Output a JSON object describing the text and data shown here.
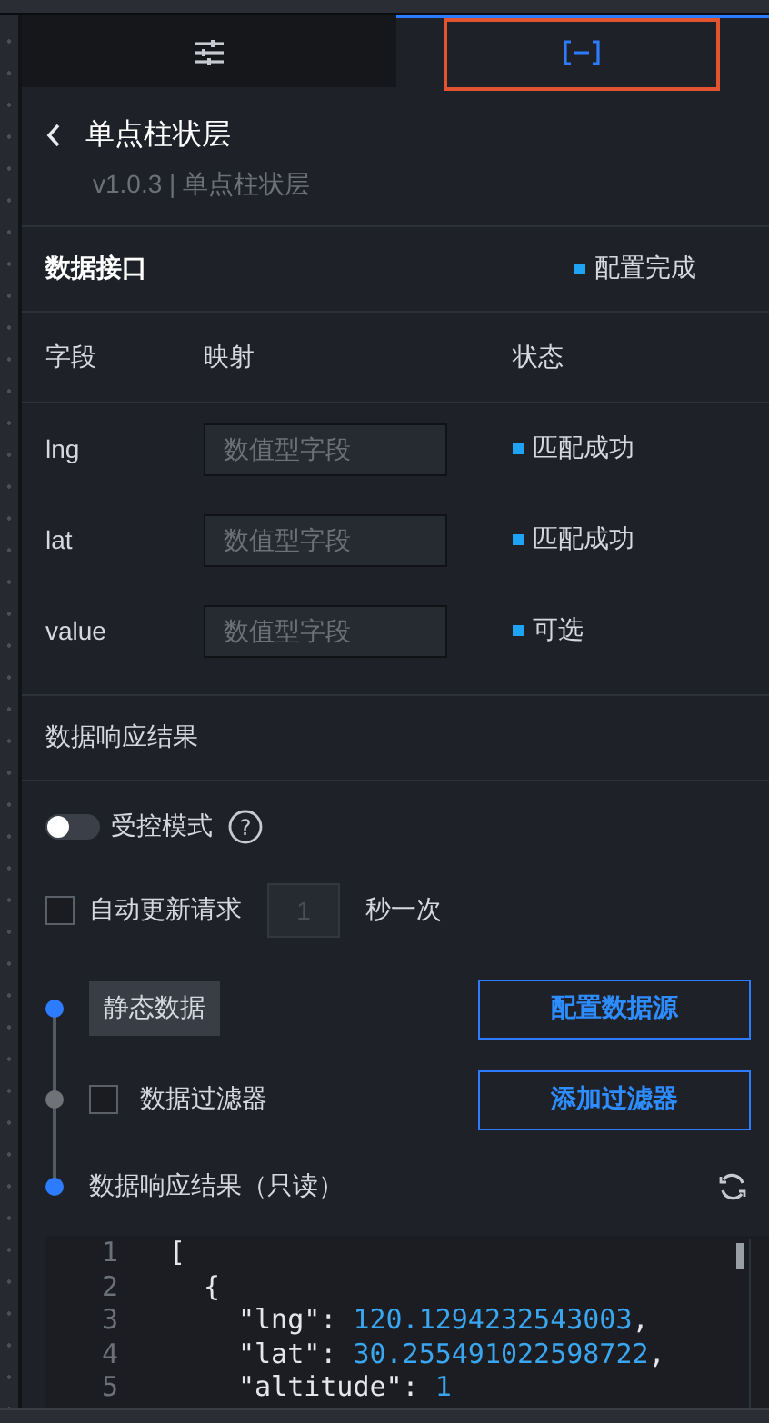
{
  "tabs": [
    {
      "kind": "sliders",
      "selected": false,
      "highlighted": false
    },
    {
      "kind": "bracket",
      "selected": true,
      "highlighted": true
    }
  ],
  "header": {
    "title": "单点柱状层",
    "subtitle": "v1.0.3 | 单点柱状层"
  },
  "data_interface": {
    "title": "数据接口",
    "status": "配置完成"
  },
  "field_table": {
    "columns": [
      "字段",
      "映射",
      "状态"
    ],
    "rows": [
      {
        "field": "lng",
        "placeholder": "数值型字段",
        "status": "匹配成功"
      },
      {
        "field": "lat",
        "placeholder": "数值型字段",
        "status": "匹配成功"
      },
      {
        "field": "value",
        "placeholder": "数值型字段",
        "status": "可选"
      }
    ]
  },
  "response_title": "数据响应结果",
  "controlled_mode": {
    "label": "受控模式",
    "on": false,
    "help": "?"
  },
  "auto_update": {
    "label": "自动更新请求",
    "checked": false,
    "value": "1",
    "unit": "秒一次"
  },
  "pipeline": [
    {
      "kind": "source",
      "active": true,
      "label": "静态数据",
      "button": "配置数据源"
    },
    {
      "kind": "filter",
      "active": false,
      "label": "数据过滤器",
      "checked": false,
      "button": "添加过滤器"
    },
    {
      "kind": "result",
      "active": true,
      "label": "数据响应结果（只读）"
    }
  ],
  "code": [
    {
      "number": "1",
      "tokens": [
        {
          "kind": "punct",
          "text": "["
        }
      ],
      "children": [
        {
          "number": "2",
          "tokens": [
            {
              "kind": "punct",
              "text": "{"
            }
          ],
          "children": [
            {
              "number": "3",
              "tokens": [
                {
                  "kind": "key",
                  "text": "\"lng\": "
                },
                {
                  "kind": "number",
                  "text": "120.1294232543003"
                },
                {
                  "kind": "punct",
                  "text": ","
                }
              ]
            },
            {
              "number": "4",
              "tokens": [
                {
                  "kind": "key",
                  "text": "\"lat\": "
                },
                {
                  "kind": "number",
                  "text": "30.255491022598722"
                },
                {
                  "kind": "punct",
                  "text": ","
                }
              ]
            },
            {
              "number": "5",
              "tokens": [
                {
                  "kind": "key",
                  "text": "\"altitude\": "
                },
                {
                  "kind": "number",
                  "text": "1"
                }
              ]
            }
          ]
        }
      ]
    }
  ]
}
